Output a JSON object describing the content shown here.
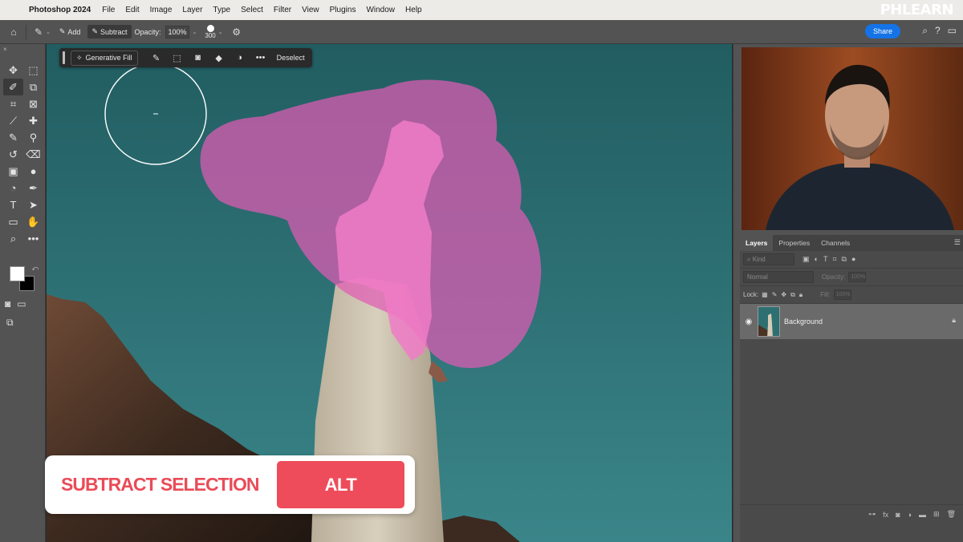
{
  "menubar": {
    "apple_icon": "apple-logo",
    "app_name": "Photoshop 2024",
    "items": [
      "File",
      "Edit",
      "Image",
      "Layer",
      "Type",
      "Select",
      "Filter",
      "View",
      "Plugins",
      "Window",
      "Help"
    ],
    "brand": "PHLEARN"
  },
  "options_bar": {
    "home_icon": "⌂",
    "tool_icon": "✎",
    "add_label": "Add",
    "subtract_label": "Subtract",
    "opacity_label": "Opacity:",
    "opacity_value": "100%",
    "brush_size": "300",
    "share_label": "Share",
    "search_icon": "⌕",
    "help_icon": "?",
    "layout_icon": "▭"
  },
  "tools": [
    {
      "name": "move-tool",
      "glyph": "✥"
    },
    {
      "name": "marquee-tool",
      "glyph": "⬚"
    },
    {
      "name": "quick-selection-tool",
      "glyph": "✐",
      "active": true
    },
    {
      "name": "object-selection-tool",
      "glyph": "⧉"
    },
    {
      "name": "crop-tool",
      "glyph": "⌗"
    },
    {
      "name": "frame-tool",
      "glyph": "⊠"
    },
    {
      "name": "eyedropper-tool",
      "glyph": "⟋"
    },
    {
      "name": "healing-brush-tool",
      "glyph": "✚"
    },
    {
      "name": "brush-tool",
      "glyph": "✎"
    },
    {
      "name": "clone-stamp-tool",
      "glyph": "⚲"
    },
    {
      "name": "history-brush-tool",
      "glyph": "↺"
    },
    {
      "name": "eraser-tool",
      "glyph": "⌫"
    },
    {
      "name": "gradient-tool",
      "glyph": "▣"
    },
    {
      "name": "blur-tool",
      "glyph": "●"
    },
    {
      "name": "dodge-tool",
      "glyph": "◔"
    },
    {
      "name": "pen-tool",
      "glyph": "✒"
    },
    {
      "name": "type-tool",
      "glyph": "T"
    },
    {
      "name": "path-selection-tool",
      "glyph": "➤"
    },
    {
      "name": "rectangle-tool",
      "glyph": "▭"
    },
    {
      "name": "hand-tool",
      "glyph": "✋"
    },
    {
      "name": "zoom-tool",
      "glyph": "⌕"
    },
    {
      "name": "more-tools",
      "glyph": "•••"
    }
  ],
  "context_bar": {
    "generative_fill_label": "Generative Fill",
    "deselect_label": "Deselect",
    "icons": [
      "brush-icon",
      "select-subject-icon",
      "mask-icon",
      "fill-icon",
      "adjust-icon",
      "more-icon"
    ]
  },
  "layers_panel": {
    "tabs": [
      "Layers",
      "Properties",
      "Channels"
    ],
    "kind_placeholder": "Kind",
    "blend_mode": "Normal",
    "opacity_label": "Opacity:",
    "opacity_value": "100%",
    "lock_label": "Lock:",
    "fill_label": "Fill:",
    "fill_value": "100%",
    "layer_name": "Background"
  },
  "caption": {
    "text": "SUBTRACT SELECTION",
    "key": "ALT"
  },
  "colors": {
    "accent": "#1473e6",
    "overlay_pink": "#e05bb4",
    "caption_red": "#ee4c5a",
    "sky": "#2e6f72"
  }
}
